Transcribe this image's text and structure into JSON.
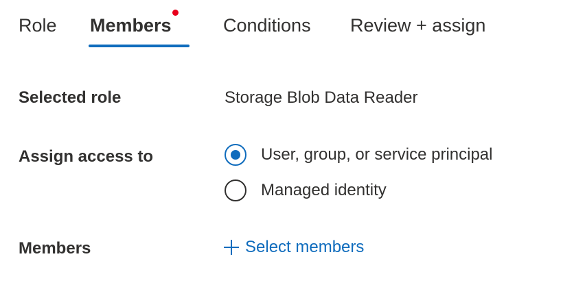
{
  "tabs": [
    {
      "label": "Role",
      "active": false
    },
    {
      "label": "Members",
      "active": true,
      "required": true
    },
    {
      "label": "Conditions",
      "active": false
    },
    {
      "label": "Review + assign",
      "active": false
    }
  ],
  "form": {
    "selected_role_label": "Selected role",
    "selected_role_value": "Storage Blob Data Reader",
    "assign_access_label": "Assign access to",
    "assign_access_options": [
      {
        "label": "User, group, or service principal",
        "selected": true
      },
      {
        "label": "Managed identity",
        "selected": false
      }
    ],
    "members_label": "Members",
    "select_members_link": "Select members"
  },
  "colors": {
    "accent": "#0f6cbd",
    "required_dot": "#e8001c",
    "text": "#323130"
  },
  "icons": {
    "select_members": "plus-icon",
    "required_indicator": "required-dot-icon"
  }
}
